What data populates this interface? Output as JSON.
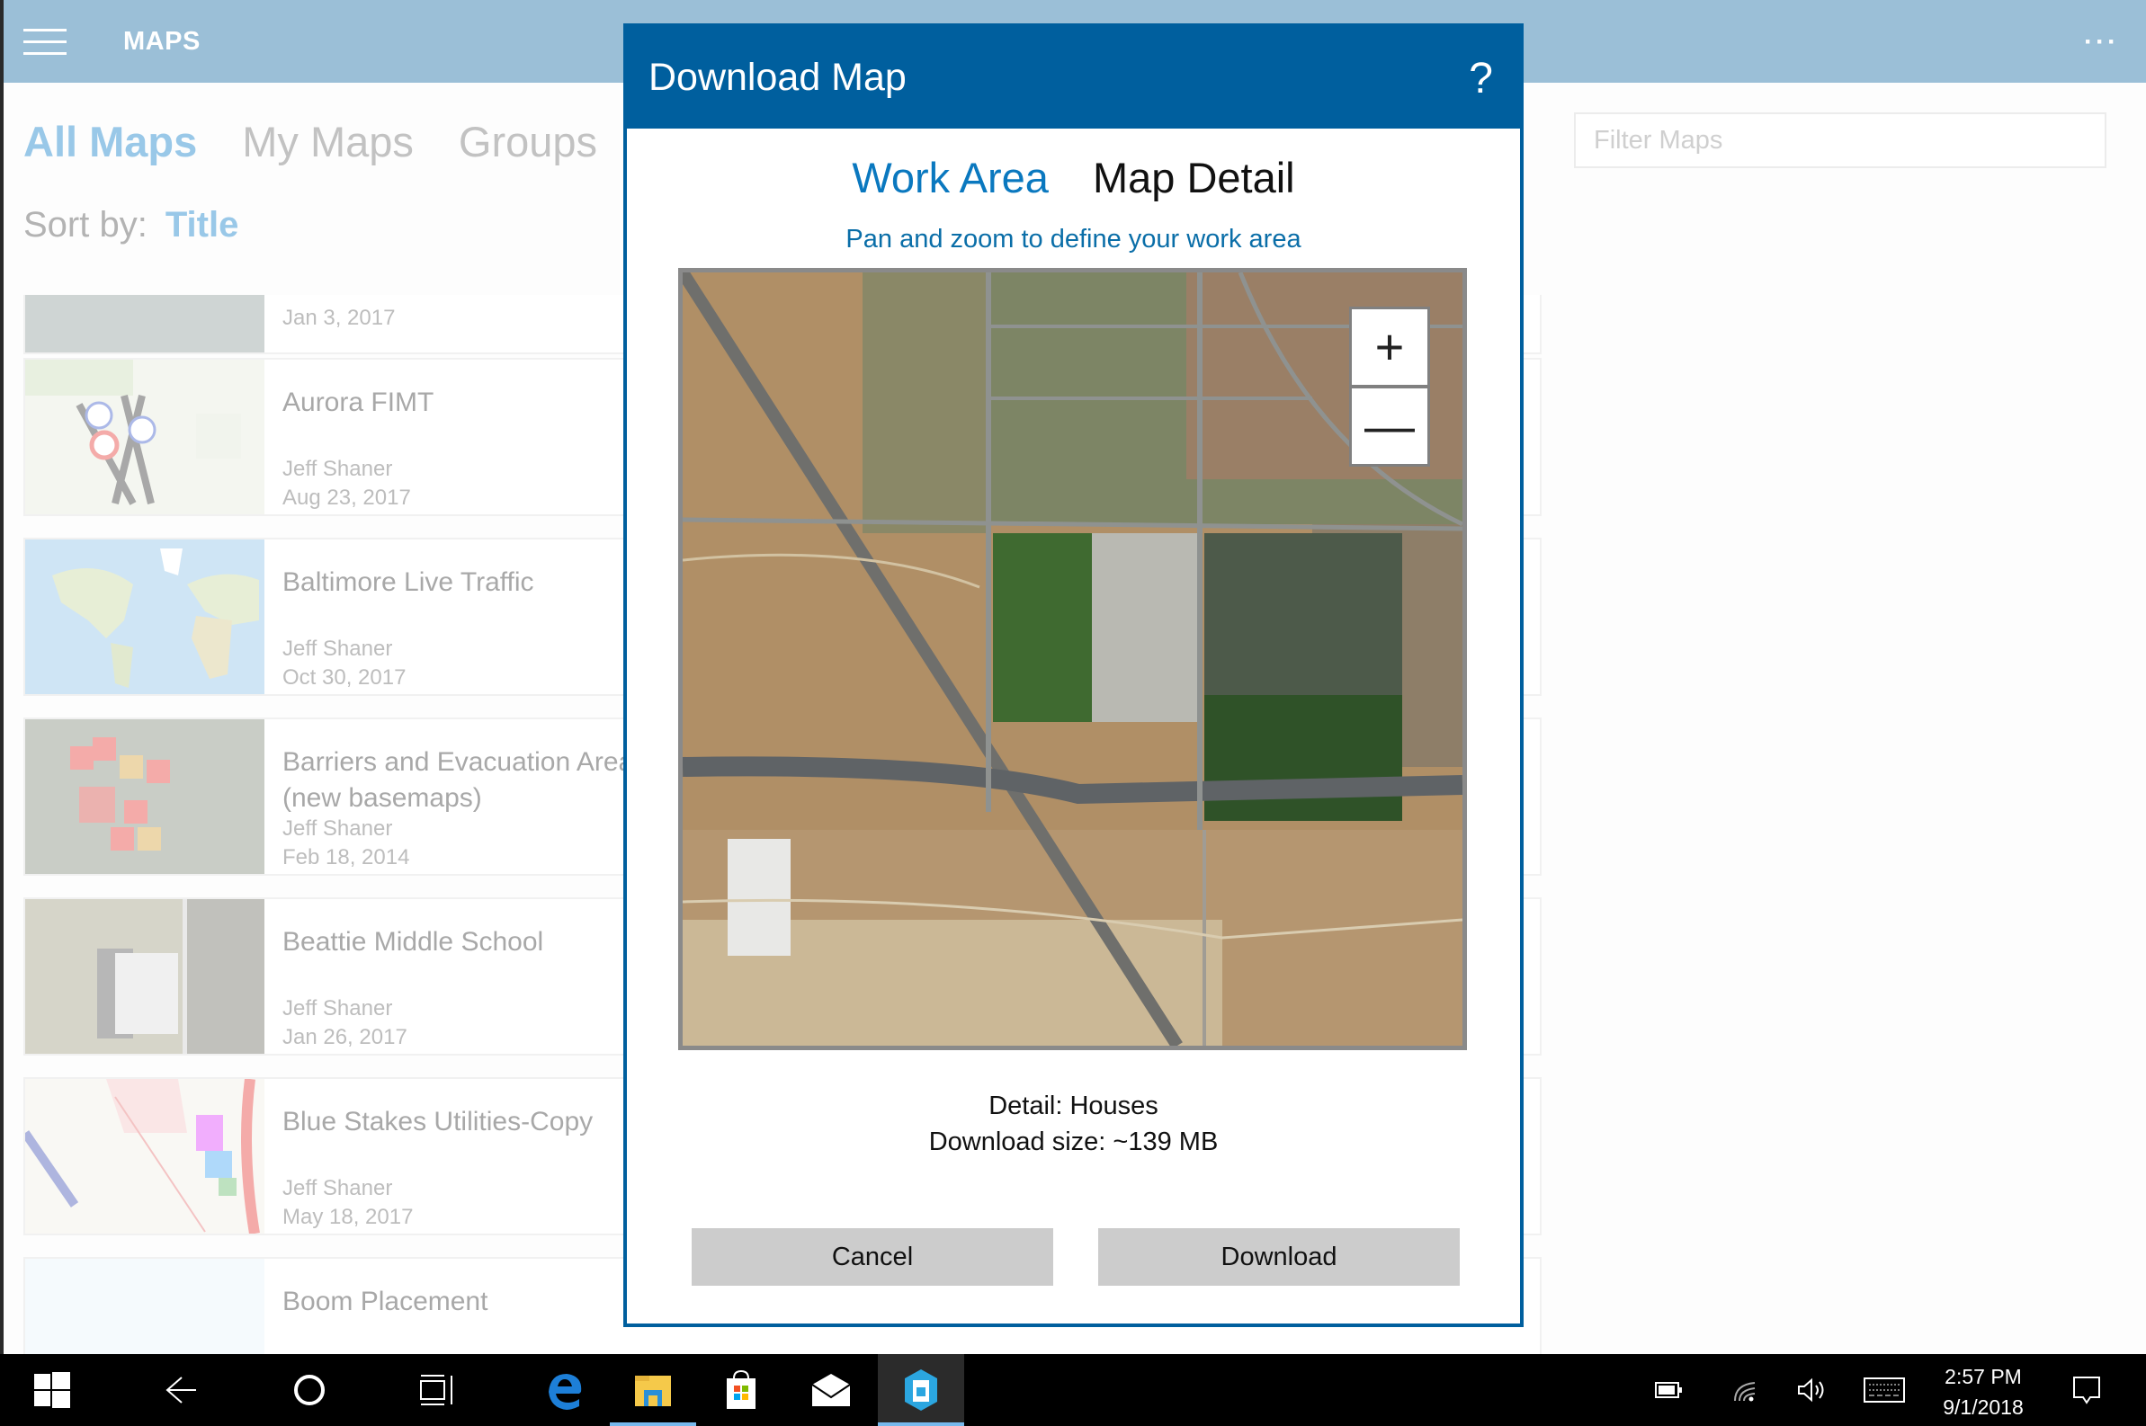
{
  "app": {
    "title": "MAPS",
    "tabs": [
      {
        "label": "All Maps",
        "active": true
      },
      {
        "label": "My Maps",
        "active": false
      },
      {
        "label": "Groups",
        "active": false
      }
    ],
    "sort": {
      "label": "Sort by:",
      "value": "Title"
    },
    "filter": {
      "placeholder": "Filter Maps",
      "value": ""
    },
    "maps": [
      {
        "title": "",
        "author": "",
        "date": "Jan 3, 2017"
      },
      {
        "title": "Aurora FIMT",
        "author": "Jeff Shaner",
        "date": "Aug 23, 2017"
      },
      {
        "title": "Baltimore Live Traffic",
        "author": "Jeff Shaner",
        "date": "Oct 30, 2017"
      },
      {
        "title": "Barriers and Evacuation Areas (new basemaps)",
        "author": "Jeff Shaner",
        "date": "Feb 18, 2014"
      },
      {
        "title": "Beattie Middle School",
        "author": "Jeff Shaner",
        "date": "Jan 26, 2017"
      },
      {
        "title": "Blue Stakes Utilities-Copy",
        "author": "Jeff Shaner",
        "date": "May 18, 2017"
      },
      {
        "title": "Boom Placement",
        "author": "",
        "date": ""
      }
    ]
  },
  "dialog": {
    "title": "Download Map",
    "help_label": "?",
    "tabs": [
      {
        "label": "Work Area",
        "active": true
      },
      {
        "label": "Map Detail",
        "active": false
      }
    ],
    "instruction": "Pan and zoom to define your work area",
    "zoom_in_label": "+",
    "zoom_out_label": "—",
    "detail": "Detail: Houses",
    "download_size": "Download size: ~139 MB",
    "cancel_label": "Cancel",
    "download_label": "Download",
    "colors": {
      "header": "#005f9e",
      "active_tab": "#0a78bf",
      "button": "#cccccc"
    }
  },
  "taskbar": {
    "icons": [
      {
        "name": "windows-start-icon"
      },
      {
        "name": "back-icon"
      },
      {
        "name": "cortana-icon"
      },
      {
        "name": "task-view-icon"
      },
      {
        "name": "edge-icon"
      },
      {
        "name": "file-explorer-icon"
      },
      {
        "name": "store-icon"
      },
      {
        "name": "mail-icon"
      },
      {
        "name": "collector-app-icon",
        "active": true
      }
    ],
    "time": "2:57 PM",
    "date": "9/1/2018"
  }
}
